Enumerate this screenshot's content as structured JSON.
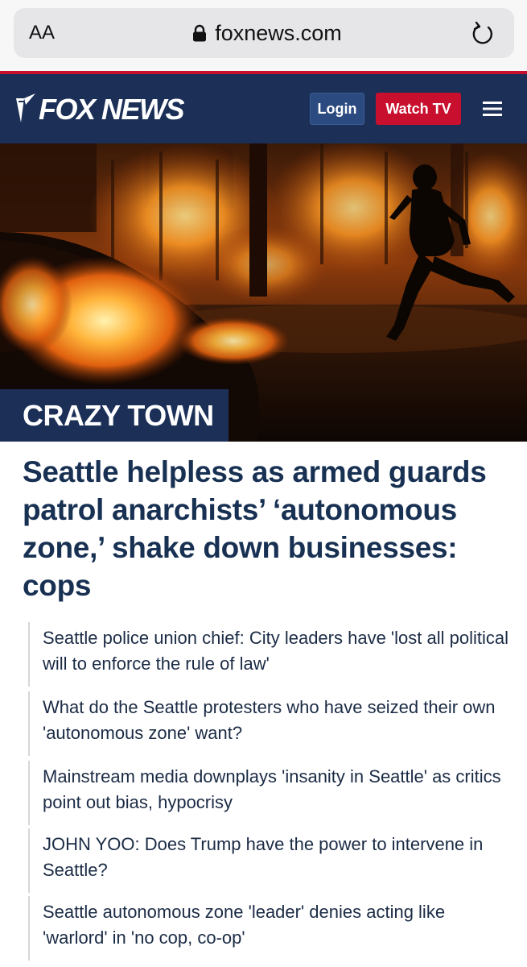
{
  "browser": {
    "text_size_label": "AA",
    "url": "foxnews.com",
    "icons": {
      "lock": "lock-icon",
      "reload": "reload-icon"
    }
  },
  "header": {
    "logo_text": "FOX NEWS",
    "login_label": "Login",
    "watch_label": "Watch TV",
    "menu_icon": "hamburger-menu-icon",
    "colors": {
      "navy": "#1b2f57",
      "red": "#c8102e"
    }
  },
  "hero": {
    "section_tag": "CRAZY TOWN"
  },
  "article": {
    "headline": "Seattle helpless as armed guards patrol anarchists’ ‘autonomous zone,’ shake down businesses: cops"
  },
  "related": [
    {
      "text": "Seattle police union chief: City leaders have 'lost all political will to enforce the rule of law'"
    },
    {
      "text": "What do the Seattle protesters who have seized their own 'autonomous zone' want?"
    },
    {
      "text": "Mainstream media downplays 'insanity in Seattle' as critics point out bias, hypocrisy"
    },
    {
      "text": "JOHN YOO: Does Trump have the power to intervene in Seattle?"
    },
    {
      "text": "Seattle autonomous zone 'leader' denies acting like 'warlord' in 'no cop, co-op'"
    }
  ]
}
